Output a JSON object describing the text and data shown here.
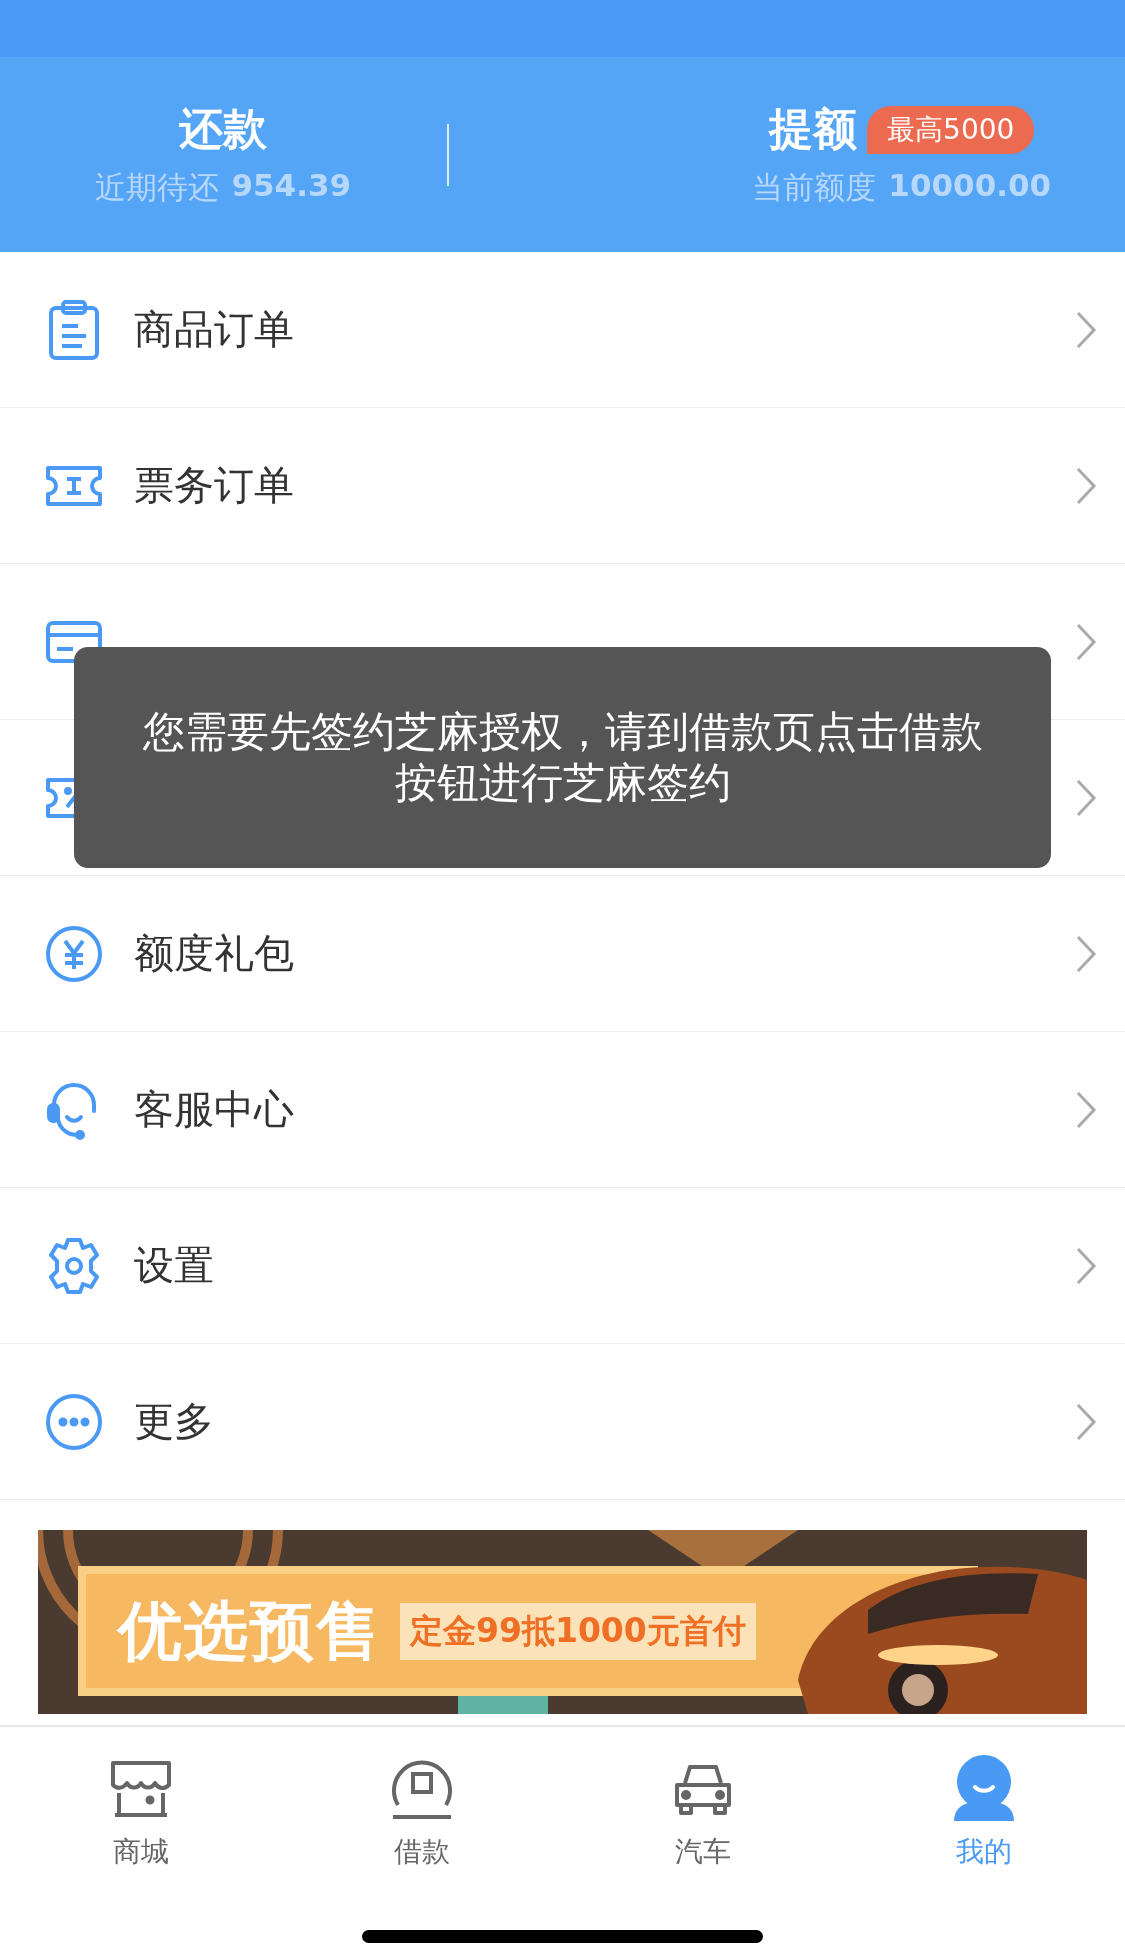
{
  "header": {
    "repay": {
      "title": "还款",
      "subtitle_label": "近期待还",
      "subtitle_value": "954.39"
    },
    "raise": {
      "title": "提额",
      "badge": "最高5000",
      "subtitle_label": "当前额度",
      "subtitle_value": "10000.00"
    }
  },
  "menu": [
    {
      "kind": "entry",
      "label": "商品订单"
    },
    {
      "kind": "entry",
      "label": "票务订单"
    },
    {
      "kind": "covered"
    },
    {
      "kind": "covered"
    },
    {
      "kind": "entry",
      "label": "额度礼包"
    },
    {
      "kind": "entry",
      "label": "客服中心"
    },
    {
      "kind": "entry",
      "label": "设置"
    },
    {
      "kind": "entry",
      "label": "更多"
    }
  ],
  "banner": {
    "title": "优选预售",
    "tagline": "定金99抵1000元首付"
  },
  "toast": {
    "message": "您需要先签约芝麻授权，请到借款页点击借款按钮进行芝麻签约"
  },
  "tabs": [
    {
      "label": "商城",
      "selected": false
    },
    {
      "label": "借款",
      "selected": false
    },
    {
      "label": "汽车",
      "selected": false
    },
    {
      "label": "我的",
      "selected": true
    }
  ]
}
